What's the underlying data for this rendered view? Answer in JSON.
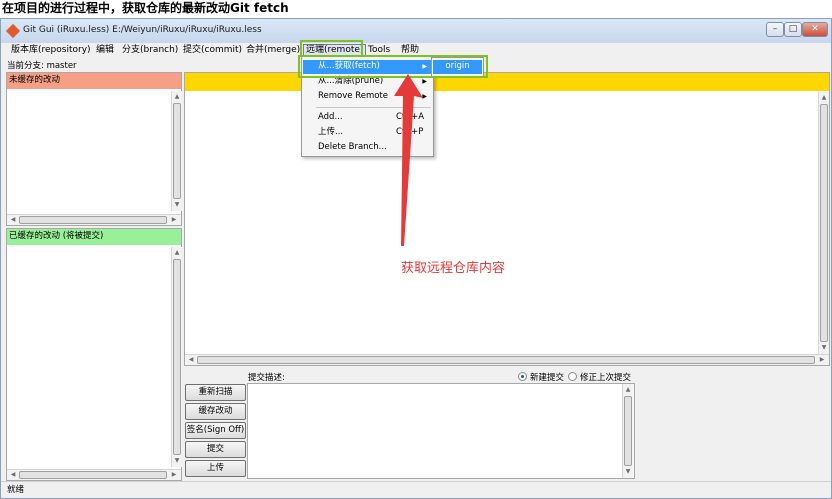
{
  "caption": "在项目的进行过程中，获取仓库的最新改动Git fetch",
  "window": {
    "title": "Git Gui (iRuxu.less) E:/Weiyun/iRuxu/iRuxu/iRuxu.less",
    "controls": {
      "minimize": "–",
      "maximize": "□",
      "close": "✕"
    }
  },
  "menubar": {
    "items": [
      "版本库(repository)",
      "编辑",
      "分支(branch)",
      "提交(commit)",
      "合并(merge)",
      "远端(remote)",
      "Tools",
      "帮助"
    ]
  },
  "branch": {
    "label": "当前分支: master"
  },
  "panes": {
    "unstaged_header": "未缓存的改动",
    "staged_header": "已缓存的改动 (将被提交)"
  },
  "commit": {
    "description_label": "提交描述:",
    "new_commit_label": "新建提交",
    "amend_label": "修正上次提交",
    "buttons": [
      "重新扫描",
      "缓存改动",
      "签名(Sign Off)",
      "提交",
      "上传"
    ]
  },
  "status": {
    "text": "就绪"
  },
  "remote_menu": {
    "fetch": "从...获取(fetch)",
    "prune": "从...清除(prune)",
    "remove": "Remove Remote",
    "add": "Add...",
    "add_accel": "Ctrl+A",
    "push": "上传...",
    "push_accel": "Ctrl+P",
    "delete_branch": "Delete Branch..."
  },
  "fetch_submenu": {
    "origin": "origin"
  },
  "annotation": {
    "text": "获取远程仓库内容",
    "color": "#e53a3a"
  },
  "colors": {
    "unstaged_header": "#f79f85",
    "staged_header": "#98f098",
    "diff_header": "#ffd700",
    "menu_highlight": "#3399ff",
    "callout_box": "#7fc21f"
  }
}
